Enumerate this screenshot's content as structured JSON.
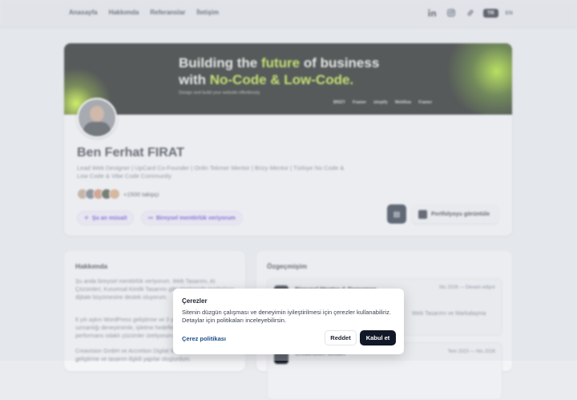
{
  "nav": {
    "links": [
      "Anasayfa",
      "Hakkımda",
      "Referanslar",
      "İletişim"
    ],
    "icons": [
      "linkedin-icon",
      "instagram-icon",
      "link-icon"
    ],
    "lang_active": "TR",
    "lang_other": "EN"
  },
  "banner": {
    "title_part1": "Building the ",
    "title_highlight1": "future",
    "title_part2": " of business",
    "title_part3": "with ",
    "title_highlight2": "No-Code & Low-Code.",
    "subtitle": "Design and build your website effortlessly.",
    "logos": [
      "BRIZY",
      "Framer",
      "shopify",
      "Webflow",
      "Framer"
    ],
    "accent_color": "#b9e43a"
  },
  "profile": {
    "name": "Ben Ferhat FIRAT",
    "bio": "Lead Web Designer | UpCard Co-Founder | Onlin Tekmer Mentor | Brizy Mentor | Türkiye No Code & Low Code & Vibe Code Community",
    "followers": "+1500 takipçi",
    "chip_available": "Şu an müsait",
    "chip_mentor": "Bireysel mentörlük veriyorum",
    "portfolio_button": "Portfolyoyu görüntüle"
  },
  "about": {
    "title": "Hakkımda",
    "p1": "Şu anda bireysel mentörlük veriyorum. Web Tasarımı, AI Çözümleri, Kurumsal Kimlik Tasarımı gibi alanlarında markaların dijitale büyümesine destek oluyorum.",
    "p2": "6 yılı aşkın WordPress geliştirme ve 3 yılı aşkın no-code uzmanlığı deneyimimle, işletme hedeflerine uygun, hızlı ve performans odaklı çözümler üretiyorum.",
    "p3": "Creavision GmbH ve Accretion Digital ile ekiplerde web geliştirme ve tasarım ilişkili yapılar oluşturdum."
  },
  "cv": {
    "title": "Özgeçmişim",
    "item1_title": "Bireysel Mentor & Danışman",
    "item1_date": "Nis 2026 — Devam ediyor",
    "item1_desc": "Web Tasarımı ve Markalaşma",
    "item2_title": "Creavision GmbH",
    "item2_date": "Tem 2023 — Nis 2026"
  },
  "cookie": {
    "title": "Çerezler",
    "text": "Sitenin düzgün çalışması ve deneyimin iyileştirilmesi için çerezler kullanabiliriz. Detaylar için politikaları inceleyebilirsin.",
    "policy_link": "Çerez politikası",
    "reject": "Reddet",
    "accept": "Kabul et"
  }
}
